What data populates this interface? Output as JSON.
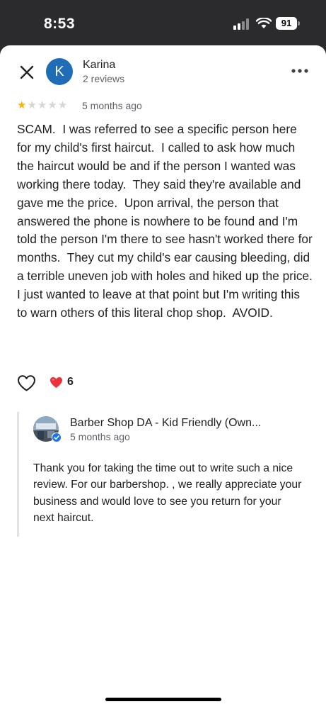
{
  "status_bar": {
    "time": "8:53",
    "battery": "91"
  },
  "reviewer": {
    "initial": "K",
    "name": "Karina",
    "review_count": "2 reviews",
    "rating": 1,
    "rating_max": 5,
    "time": "5 months ago"
  },
  "review": {
    "text": "SCAM.  I was referred to see a specific person here for my child's first haircut.  I called to ask how much the haircut would be and if the person I wanted was working there today.  They said they're available and gave me the price.  Upon arrival, the person that answered the phone is nowhere to be found and I'm told the person I'm there to see hasn't worked there for months.  They cut my child's ear causing bleeding, did a terrible uneven job with holes and hiked up the price.  I just wanted to leave at that point but I'm writing this to warn others of this literal chop shop.  AVOID."
  },
  "reactions": {
    "heart_count": "6"
  },
  "owner_reply": {
    "name": "Barber Shop DA - Kid Friendly (Own...",
    "time": "5 months ago",
    "text": "Thank you for taking the time out to write such a nice review. For our barbershop. , we really appreciate your business and would love to see you return for your next haircut."
  },
  "colors": {
    "avatar": "#1f6cb7",
    "star_filled": "#f6b500",
    "star_empty": "#d6d6d6",
    "heart": "#e8323c",
    "verified": "#1a73e8"
  },
  "icons": [
    "close-icon",
    "more-options-icon",
    "heart-outline-icon",
    "heart-emoji-icon",
    "verified-badge-icon",
    "signal-icon",
    "wifi-icon",
    "battery-icon"
  ]
}
